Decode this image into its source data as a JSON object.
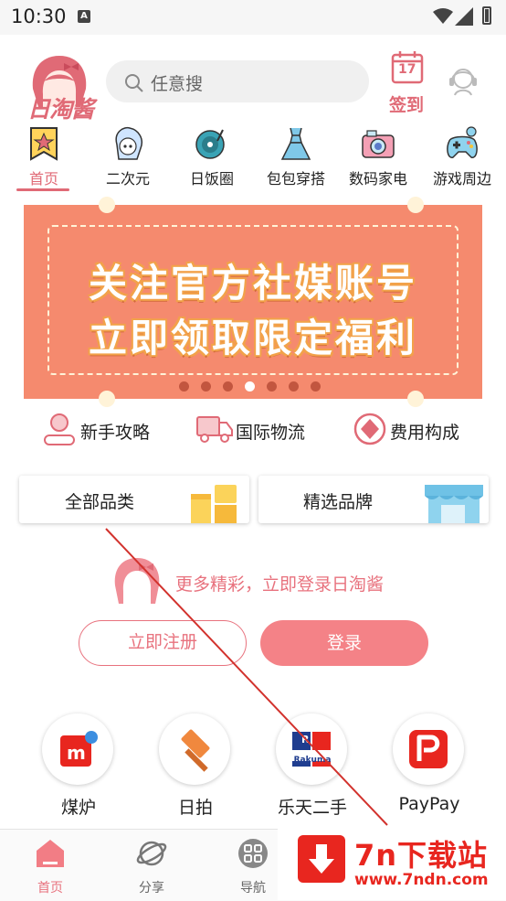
{
  "status_bar": {
    "time": "10:30",
    "notification_glyph": "A"
  },
  "header": {
    "logo_text": "日淘酱",
    "search_placeholder": "任意搜",
    "checkin_day": "17",
    "checkin_label": "签到",
    "icons": {
      "search": "search-icon",
      "checkin": "calendar-icon",
      "service": "customer-service-icon"
    }
  },
  "categories": [
    {
      "label": "首页",
      "icon": "star-bookmark-icon",
      "active": true
    },
    {
      "label": "二次元",
      "icon": "anime-character-icon"
    },
    {
      "label": "日饭圈",
      "icon": "vinyl-record-icon"
    },
    {
      "label": "包包穿搭",
      "icon": "dress-icon"
    },
    {
      "label": "数码家电",
      "icon": "camera-icon"
    },
    {
      "label": "游戏周边",
      "icon": "gamepad-icon"
    }
  ],
  "banner": {
    "line1": "关注官方社媒账号",
    "line2": "立即领取限定福利",
    "slide_count": 7,
    "active_slide": 4
  },
  "quick_links": [
    {
      "label": "新手攻略",
      "icon": "guide-person-icon"
    },
    {
      "label": "国际物流",
      "icon": "truck-icon"
    },
    {
      "label": "费用构成",
      "icon": "coin-icon"
    }
  ],
  "category_cards": [
    {
      "label": "全部品类",
      "icon": "grid-blocks-icon"
    },
    {
      "label": "精选品牌",
      "icon": "storefront-icon"
    }
  ],
  "login_promo": {
    "text": "更多精彩，立即登录日淘酱",
    "register_label": "立即注册",
    "login_label": "登录"
  },
  "platforms": [
    {
      "label": "煤炉",
      "icon": "mercari-icon"
    },
    {
      "label": "日拍",
      "icon": "auction-hammer-icon"
    },
    {
      "label": "乐天二手",
      "icon": "rakuma-icon",
      "icon_text": "Rakuma"
    },
    {
      "label": "PayPay",
      "icon": "paypay-icon"
    }
  ],
  "bottom_nav": [
    {
      "label": "首页",
      "icon": "home-icon",
      "active": true
    },
    {
      "label": "分享",
      "icon": "planet-icon"
    },
    {
      "label": "导航",
      "icon": "grid-icon"
    }
  ],
  "watermark": {
    "title": "7n下载站",
    "url": "www.7ndn.com"
  },
  "colors": {
    "brand_pink": "#e8727e",
    "banner_orange": "#f58a6e",
    "login_button": "#f48287",
    "watermark_red": "#e8261f"
  }
}
